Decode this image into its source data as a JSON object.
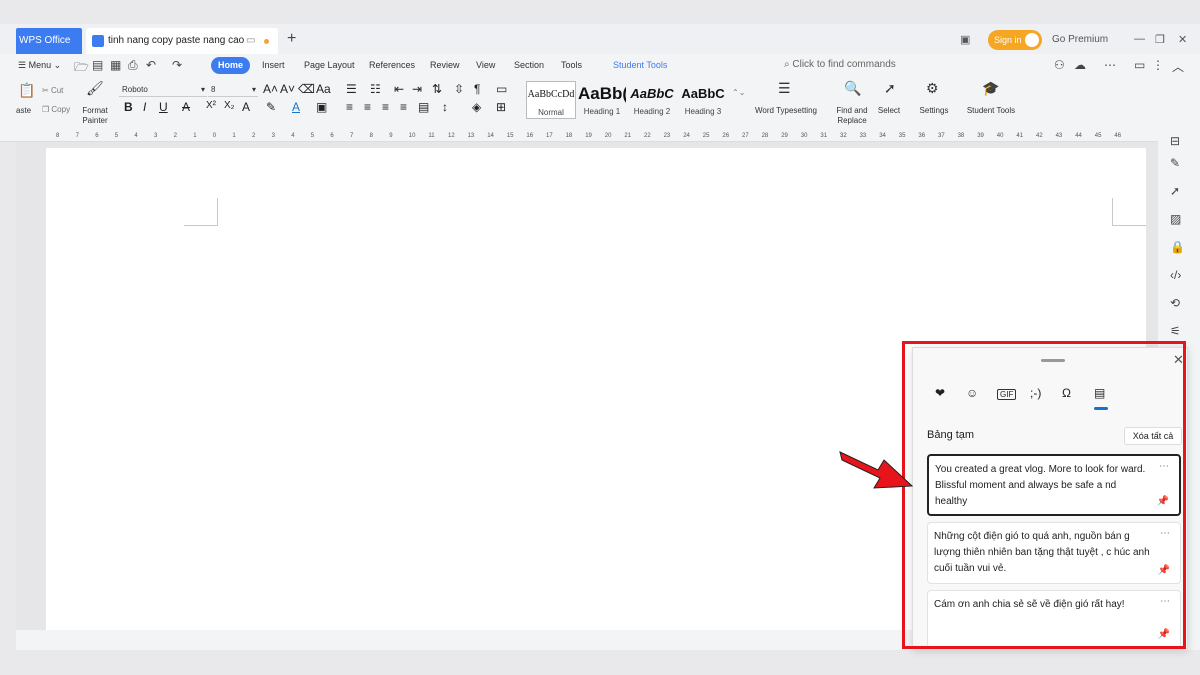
{
  "titlebar": {
    "app_tab": "WPS Office",
    "doc_tab": "tinh nang copy paste nang cao",
    "sign_in": "Sign in",
    "go_premium": "Go Premium"
  },
  "menubar": {
    "menu": "Menu",
    "tabs": [
      "Home",
      "Insert",
      "Page Layout",
      "References",
      "Review",
      "View",
      "Section",
      "Tools",
      "Student Tools"
    ],
    "search_placeholder": "Click to find commands"
  },
  "ribbon": {
    "paste": "aste",
    "cut": "Cut",
    "copy": "Copy",
    "format_painter": "Format Painter",
    "font": "Roboto",
    "font_size": "8",
    "styles": [
      {
        "preview": "AaBbCcDd",
        "label": "Normal"
      },
      {
        "preview": "AaBb(",
        "label": "Heading 1"
      },
      {
        "preview": "AaBbC",
        "label": "Heading 2"
      },
      {
        "preview": "AaBbC",
        "label": "Heading 3"
      }
    ],
    "word_typesetting": "Word Typesetting",
    "find_replace": "Find and Replace",
    "select": "Select",
    "settings": "Settings",
    "student_tools": "Student Tools"
  },
  "clipboard": {
    "title": "Bảng tạm",
    "clear_all": "Xóa tất cả",
    "tab_icons": [
      "favorites-icon",
      "emoji-icon",
      "gif-icon",
      "kaomoji-icon",
      "symbols-icon",
      "clipboard-icon"
    ],
    "items": [
      "You created a great vlog. More to look for ward. Blissful moment and always be safe a nd healthy",
      "Những cột điện gió to quá anh, nguồn bán g lượng thiên nhiên ban tặng thật tuyệt , c húc anh cuối tuần vui vẻ.",
      "Cám ơn anh chia sẻ sẽ về điện gió rất hay!"
    ]
  },
  "colors": {
    "accent": "#3d7bf0",
    "highlight_red": "#e8141b",
    "sign_in": "#f5a623"
  }
}
